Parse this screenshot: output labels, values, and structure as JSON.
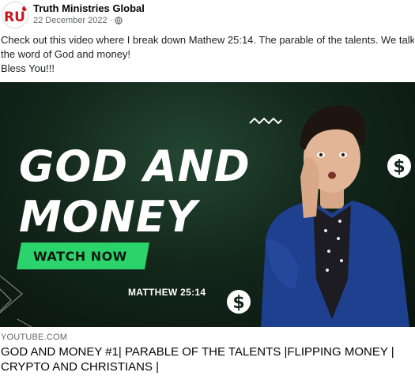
{
  "post": {
    "author": "Truth Ministries Global",
    "avatar_text": "RU",
    "date": "22 December 2022",
    "dot": "·",
    "privacy_icon": "globe-icon",
    "text_lines": [
      "Check out this video where I break down Mathew 25:14. The parable of the talents. We talk",
      "the word of God and money!",
      "Bless You!!!"
    ]
  },
  "thumbnail": {
    "headline_line1": "GOD AND",
    "headline_line2": "MONEY",
    "button_label": "WATCH NOW",
    "verse": "MATTHEW 25:14",
    "decorations": [
      "dollar-icon",
      "dollar-icon",
      "zigzag-icon"
    ],
    "colors": {
      "background": "#13271b",
      "button": "#2bd46b",
      "headline": "#ffffff",
      "jacket": "#1f3f8f"
    }
  },
  "link": {
    "source": "YOUTUBE.COM",
    "title": "GOD AND MONEY #1| PARABLE OF THE TALENTS |FLIPPING MONEY | CRYPTO AND CHRISTIANS |"
  }
}
